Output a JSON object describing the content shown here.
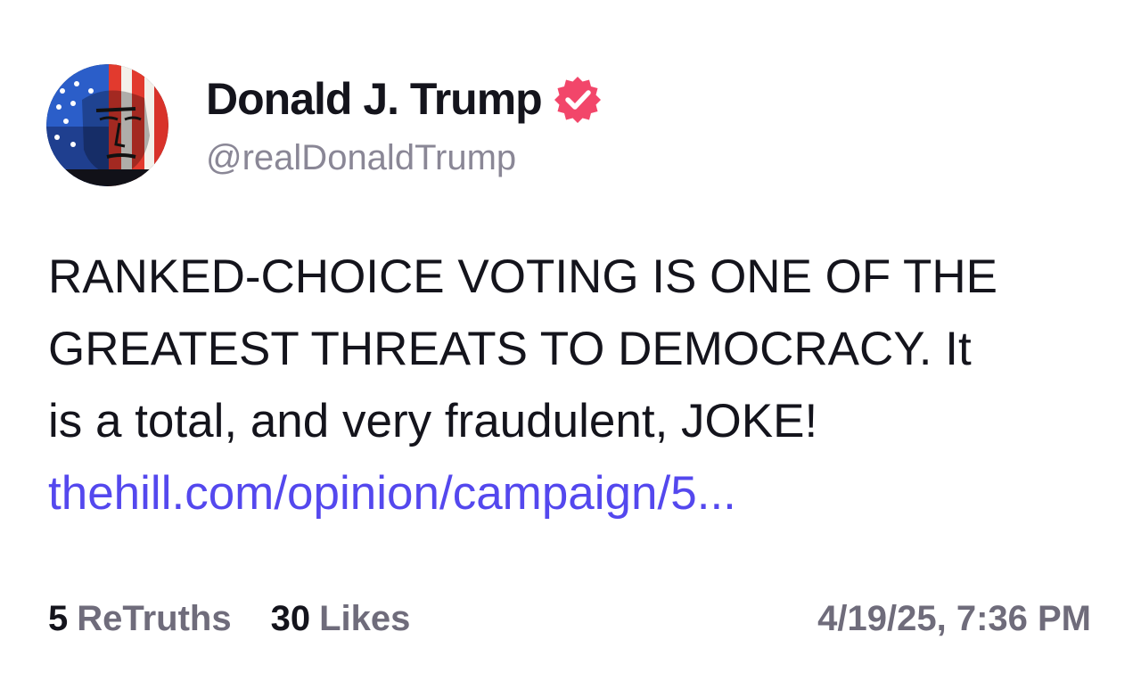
{
  "author": {
    "display_name": "Donald J. Trump",
    "handle": "@realDonaldTrump",
    "avatar_icon": "flag-portrait-avatar",
    "verified_icon": "verified-badge-icon",
    "verified_color": "#f2466a"
  },
  "post": {
    "text_lines": [
      "RANKED-CHOICE VOTING IS ONE OF THE",
      "GREATEST THREATS TO DEMOCRACY. It",
      "is a total, and very fraudulent, JOKE!"
    ],
    "link_text": "thehill.com/opinion/campaign/5...",
    "link_color": "#5448ee"
  },
  "stats": {
    "retruths_count": "5",
    "retruths_label": "ReTruths",
    "likes_count": "30",
    "likes_label": "Likes",
    "timestamp": "4/19/25, 7:36 PM"
  }
}
